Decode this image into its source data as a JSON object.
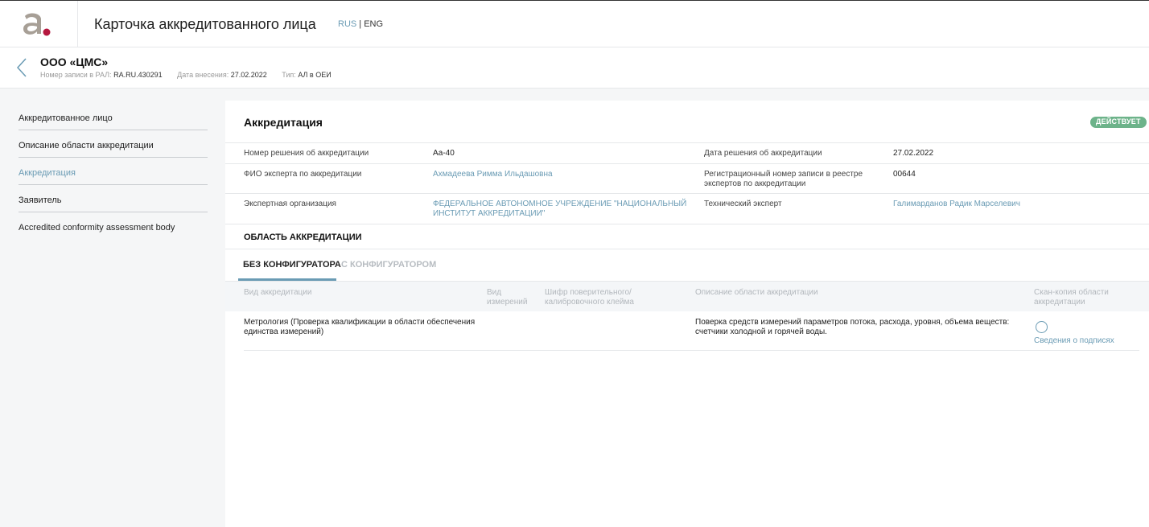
{
  "header": {
    "title": "Карточка аккредитованного лица",
    "lang_rus": "RUS",
    "lang_sep": " | ",
    "lang_eng": "ENG"
  },
  "entity": {
    "name": "ООО «ЦМС»",
    "record_label": "Номер записи в РАЛ:",
    "record_value": "RA.RU.430291",
    "date_label": "Дата внесения:",
    "date_value": "27.02.2022",
    "type_label": "Тип:",
    "type_value": "АЛ в ОЕИ"
  },
  "sidebar": {
    "items": [
      {
        "label": "Аккредитованное лицо"
      },
      {
        "label": "Описание области аккредитации"
      },
      {
        "label": "Аккредитация"
      },
      {
        "label": "Заявитель"
      },
      {
        "label": "Accredited conformity assessment body"
      }
    ]
  },
  "accreditation": {
    "title": "Аккредитация",
    "status": "ДЕЙСТВУЕТ",
    "fields": {
      "decision_number_label": "Номер решения об аккредитации",
      "decision_number_value": "Аа-40",
      "decision_date_label": "Дата решения об аккредитации",
      "decision_date_value": "27.02.2022",
      "expert_label": "ФИО эксперта по аккредитации",
      "expert_value": "Ахмадеева Римма Ильдашовна",
      "reg_number_label_1": "Регистрационный номер записи в реестре",
      "reg_number_label_2": "экспертов по аккредитации",
      "reg_number_value": "00644",
      "org_label": "Экспертная организация",
      "org_value_1": "ФЕДЕРАЛЬНОЕ АВТОНОМНОЕ УЧРЕЖДЕНИЕ \"НАЦИОНАЛЬНЫЙ",
      "org_value_2": "ИНСТИТУТ АККРЕДИТАЦИИ\"",
      "tech_expert_label": "Технический эксперт",
      "tech_expert_value": "Галимарданов Радик Марселевич"
    },
    "scope_title": "ОБЛАСТЬ АККРЕДИТАЦИИ",
    "tabs": [
      {
        "label": "БЕЗ КОНФИГУРАТОРА"
      },
      {
        "label": "С КОНФИГУРАТОРОМ"
      }
    ],
    "table": {
      "headers": {
        "type": "Вид аккредитации",
        "measure_1": "Вид",
        "measure_2": "измерений",
        "cipher_1": "Шифр поверительного/",
        "cipher_2": "калибровочного клейма",
        "desc": "Описание области аккредитации",
        "scan_1": "Скан-копия области",
        "scan_2": "аккредитации"
      },
      "row": {
        "type_1": "Метрология (Проверка квалификации в области обеспечения",
        "type_2": "единства измерений)",
        "desc_1": "Поверка средств измерений параметров потока, расхода, уровня, объема веществ:",
        "desc_2": "счетчики холодной и горячей воды.",
        "sign_link": "Сведения о подписях"
      }
    }
  },
  "colors": {
    "accent": "#6a9bb4",
    "status": "#6db38a",
    "logo_dot": "#b5183f",
    "logo_letter": "#a79f96"
  },
  "icons": {
    "logo": "logo-icon",
    "back": "chevron-left-icon",
    "scan": "circle-icon"
  }
}
